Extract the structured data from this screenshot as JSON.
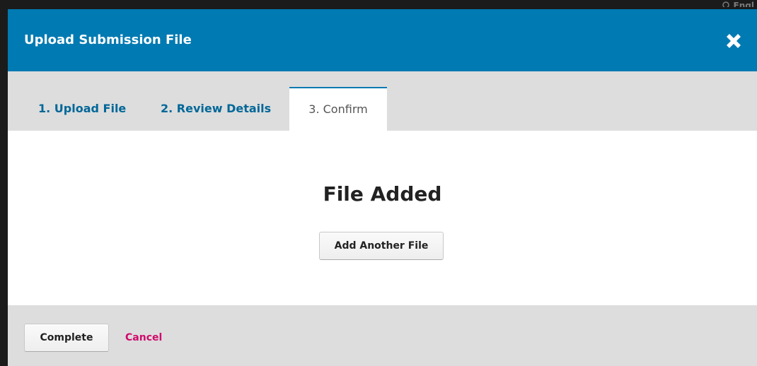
{
  "background": {
    "corner_text": "Engl"
  },
  "modal": {
    "title": "Upload Submission File",
    "close_icon": "close-x-icon",
    "accent_color": "#007ab2",
    "tabs": [
      {
        "label": "1. Upload File",
        "active": false
      },
      {
        "label": "2. Review Details",
        "active": false
      },
      {
        "label": "3. Confirm",
        "active": true
      }
    ],
    "content": {
      "heading": "File Added",
      "add_another_label": "Add Another File"
    },
    "footer": {
      "complete_label": "Complete",
      "cancel_label": "Cancel",
      "cancel_color": "#d00a6c"
    }
  }
}
